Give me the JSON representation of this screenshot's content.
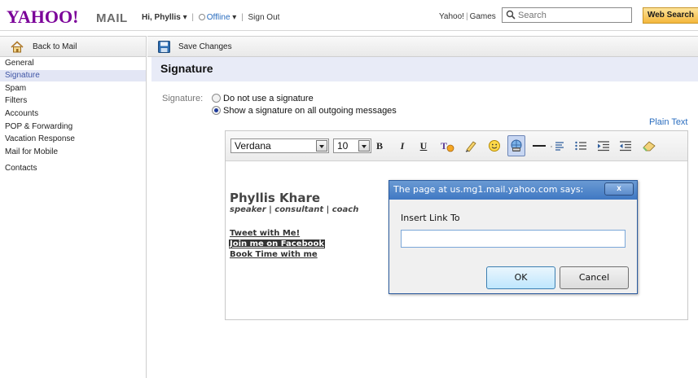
{
  "header": {
    "logo": "YAHOO!",
    "logo_mail": "MAIL",
    "greeting": "Hi, Phyllis",
    "status": "Offline",
    "sign_out": "Sign Out",
    "yahoo_link": "Yahoo!",
    "games_link": "Games",
    "search_placeholder": "Search",
    "web_search": "Web Search"
  },
  "sidebar": {
    "back": "Back to Mail",
    "items": [
      {
        "label": "General"
      },
      {
        "label": "Signature"
      },
      {
        "label": "Spam"
      },
      {
        "label": "Filters"
      },
      {
        "label": "Accounts"
      },
      {
        "label": "POP & Forwarding"
      },
      {
        "label": "Vacation Response"
      },
      {
        "label": "Mail for Mobile"
      },
      {
        "label": "Contacts"
      }
    ],
    "active_index": 1
  },
  "main": {
    "save_changes": "Save Changes",
    "title": "Signature",
    "signature_label": "Signature:",
    "option_none": "Do not use a signature",
    "option_show": "Show a signature on all outgoing messages",
    "plain_text": "Plain Text"
  },
  "editor": {
    "font": "Verdana",
    "size": "10",
    "bold": "B",
    "italic": "I",
    "underline": "U",
    "name": "Phyllis Khare",
    "role": "speaker | consultant | coach",
    "links": [
      "Tweet with Me!",
      "Join me on Facebook",
      "Book Time with me"
    ]
  },
  "dialog": {
    "title": "The page at us.mg1.mail.yahoo.com says:",
    "close": "x",
    "label": "Insert Link To",
    "input_value": "",
    "ok": "OK",
    "cancel": "Cancel"
  }
}
